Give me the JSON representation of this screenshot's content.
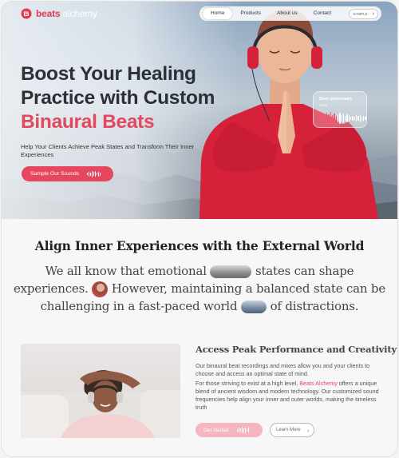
{
  "brand": {
    "name_part1": "beats",
    "name_part2": "alchemy",
    "accent": "#e7475e"
  },
  "nav": {
    "items": [
      {
        "label": "Home",
        "active": true
      },
      {
        "label": "Products",
        "active": false
      },
      {
        "label": "About us",
        "active": false
      },
      {
        "label": "Contact",
        "active": false
      }
    ],
    "cta_label": "SAMPLE",
    "cta_icon": "arrow-right-icon"
  },
  "hero": {
    "title_line1": "Boost Your Healing",
    "title_line2": "Practice with Custom",
    "title_line3": "Binaural Beats",
    "subtitle": "Help Your Clients Achieve Peak States and Transform Their Inner Experiences",
    "button_label": "Sample Our Sounds",
    "card_title": "Beat pulmonary",
    "card_sub": "1012"
  },
  "align": {
    "title": "Align Inner Experiences with the External World",
    "line1_a": "We all know that emotional",
    "line1_b": "states can shape",
    "line2_a": "experiences.",
    "line2_b": "However, maintaining a balanced state can be",
    "line3_a": "challenging in a fast-paced world",
    "line3_b": "of distractions."
  },
  "peak": {
    "title": "Access Peak Performance and Creativity",
    "p1": "Our binaural beat recordings and mixes allow you and your clients to choose and access an optimal state of mind.",
    "p2_a": "For those striving to exist at a high level,",
    "p2_brand": "Beats Alchemy",
    "p2_b": "offers a unique blend of ancient wisdom and modern technology. Our customized sound frequencies help align your inner and outer worlds, making the timeless truth",
    "get_started_label": "Get started",
    "learn_more_label": "Learn More"
  }
}
